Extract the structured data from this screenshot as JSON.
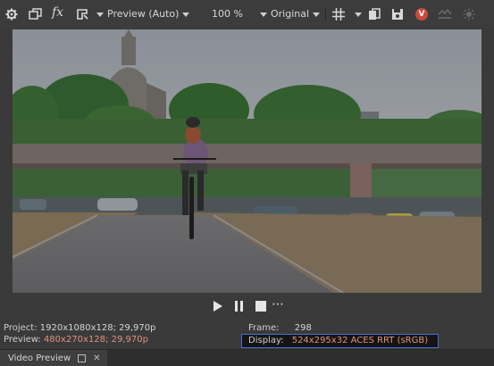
{
  "toolbar": {
    "fx_label": "fx",
    "preview_quality": "Preview (Auto)",
    "zoom": "100 %",
    "view_mode": "Original",
    "v_badge": "V"
  },
  "transport": {
    "more": "⋯"
  },
  "info": {
    "project_label": "Project:",
    "project_value": "1920x1080x128; 29,970p",
    "preview_label": "Preview:",
    "preview_value": "480x270x128; 29,970p",
    "frame_label": "Frame:",
    "frame_value": "298",
    "display_label": "Display:",
    "display_value": "524x295x32 ACES RRT (sRGB)"
  },
  "panel": {
    "tab_title": "Video Preview",
    "close_glyph": "✕"
  },
  "colors": {
    "accent_border": "#4a6fd6",
    "preview_value_color": "#e0927a",
    "badge": "#c94a3c"
  }
}
